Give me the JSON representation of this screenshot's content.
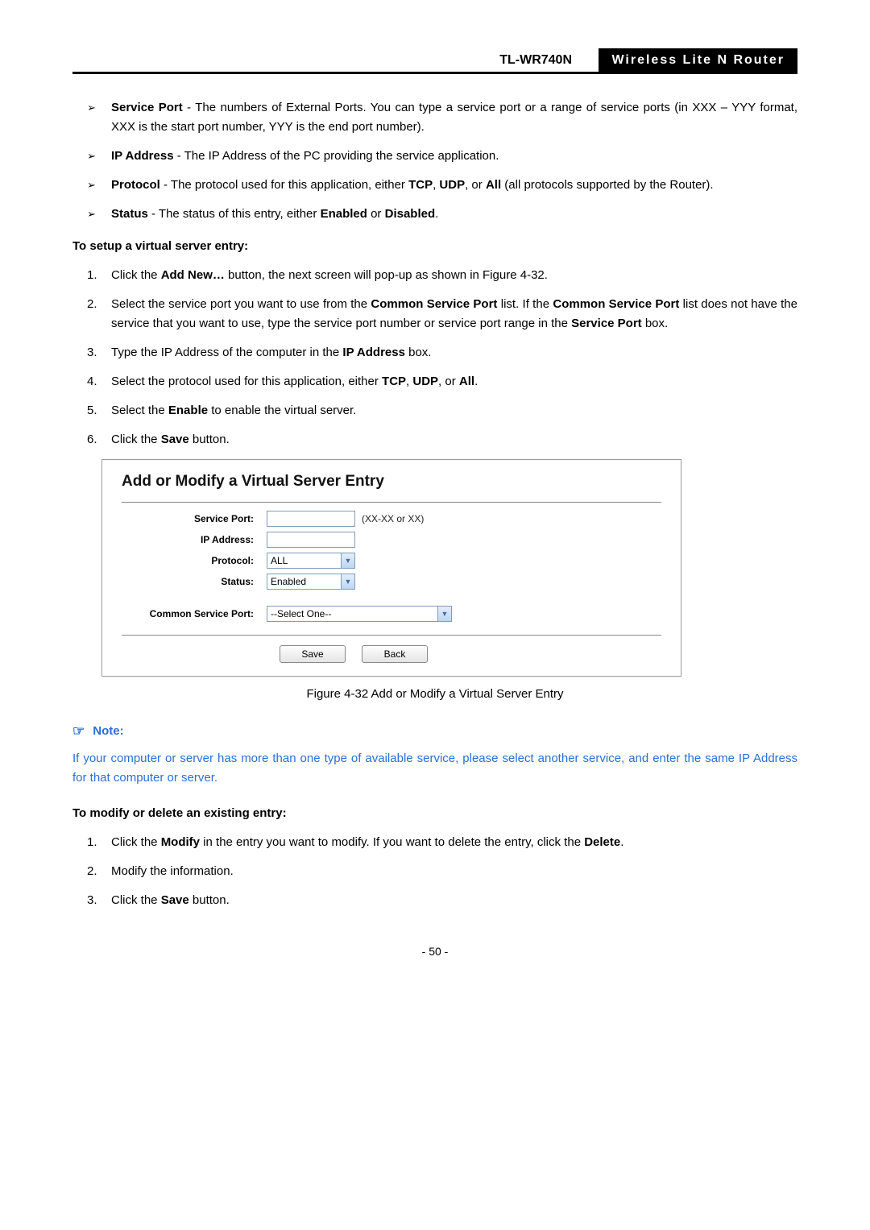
{
  "header": {
    "model": "TL-WR740N",
    "desc": "Wireless Lite N Router"
  },
  "bullets": [
    {
      "label": "Service Port",
      "text": " - The numbers of External Ports. You can type a service port or a range of service ports (in XXX – YYY format, XXX is the start port number, YYY is the end port number)."
    },
    {
      "label": "IP Address",
      "text": " - The IP Address of the PC providing the service application."
    },
    {
      "label": "Protocol",
      "text": " - The protocol used for this application, either ",
      "suffix1": "TCP",
      "mid": ", ",
      "suffix2": "UDP",
      "mid2": ", or ",
      "suffix3": "All",
      "tail": " (all protocols supported by the Router)."
    },
    {
      "label": "Status",
      "text": " - The status of this entry, either ",
      "suffix1": "Enabled",
      "mid": " or ",
      "suffix2": "Disabled",
      "tail": "."
    }
  ],
  "setup": {
    "heading": "To setup a virtual server entry:",
    "steps": [
      {
        "n": "1.",
        "pre": "Click the ",
        "b1": "Add New…",
        "post": " button, the next screen will pop-up as shown in Figure 4-32."
      },
      {
        "n": "2.",
        "pre": "Select the service port you want to use from the ",
        "b1": "Common Service Port",
        "mid": " list. If the ",
        "b2": "Common Service Port",
        "mid2": " list does not have the service that you want to use, type the service port number or service port range in the ",
        "b3": "Service Port",
        "post": " box."
      },
      {
        "n": "3.",
        "pre": "Type the IP Address of the computer in the ",
        "b1": "IP Address",
        "post": " box."
      },
      {
        "n": "4.",
        "pre": "Select the protocol used for this application, either ",
        "b1": "TCP",
        "mid": ", ",
        "b2": "UDP",
        "mid2": ", or ",
        "b3": "All",
        "post": "."
      },
      {
        "n": "5.",
        "pre": "Select the ",
        "b1": "Enable",
        "post": " to enable the virtual server."
      },
      {
        "n": "6.",
        "pre": "Click the ",
        "b1": "Save",
        "post": " button."
      }
    ]
  },
  "form": {
    "title": "Add or Modify a Virtual Server Entry",
    "fields": {
      "service_port": {
        "label": "Service Port:",
        "hint": "(XX-XX or XX)",
        "value": ""
      },
      "ip_address": {
        "label": "IP Address:",
        "value": ""
      },
      "protocol": {
        "label": "Protocol:",
        "value": "ALL"
      },
      "status": {
        "label": "Status:",
        "value": "Enabled"
      },
      "common": {
        "label": "Common Service Port:",
        "value": "--Select One--"
      }
    },
    "buttons": {
      "save": "Save",
      "back": "Back"
    }
  },
  "figure_caption": "Figure 4-32    Add or Modify a Virtual Server Entry",
  "note": {
    "head": "Note:",
    "body": "If your computer or server has more than one type of available service, please select another service, and enter the same IP Address for that computer or server."
  },
  "modify": {
    "heading": "To modify or delete an existing entry:",
    "steps": [
      {
        "n": "1.",
        "pre": "Click the ",
        "b1": "Modify",
        "mid": " in the entry you want to modify. If you want to delete the entry, click the ",
        "b2": "Delete",
        "post": "."
      },
      {
        "n": "2.",
        "pre": "Modify the information."
      },
      {
        "n": "3.",
        "pre": "Click the ",
        "b1": "Save",
        "post": " button."
      }
    ]
  },
  "page_num": "- 50 -"
}
